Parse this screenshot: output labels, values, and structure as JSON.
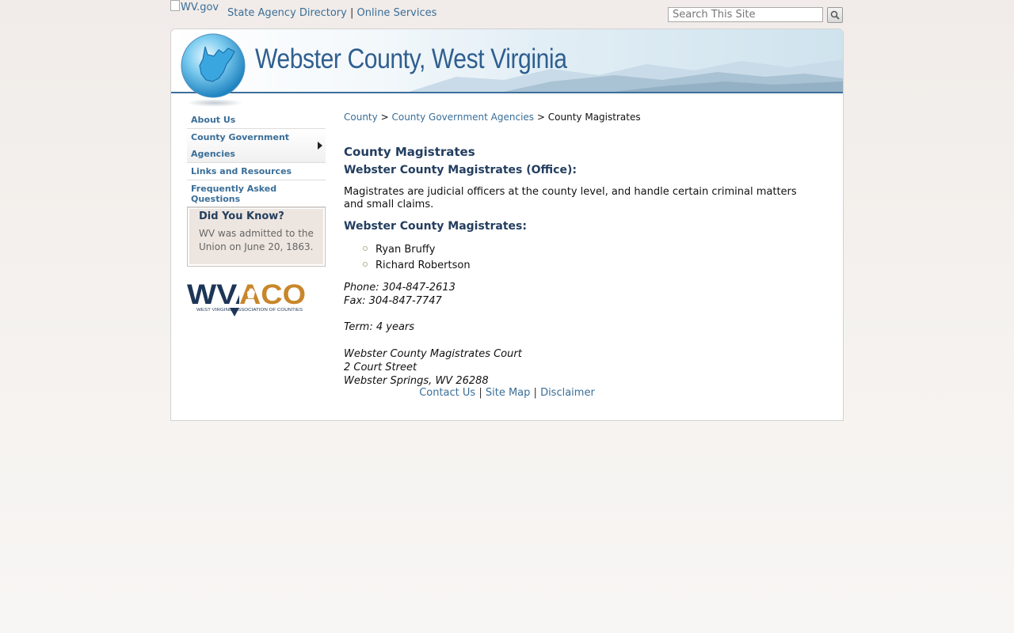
{
  "topbar": {
    "wvgov_alt": "WV.gov",
    "links": [
      {
        "label": "State Agency Directory"
      },
      {
        "label": "Online Services"
      }
    ],
    "separator": "|",
    "search_placeholder": "Search This Site"
  },
  "banner": {
    "title": "Webster County, West Virginia"
  },
  "sidebar": {
    "items": [
      {
        "label": "About Us"
      },
      {
        "label": "County Government Agencies"
      },
      {
        "label": "Links and Resources"
      },
      {
        "label": "Frequently Asked Questions"
      }
    ],
    "did_you_know": {
      "title": "Did You Know?",
      "text": "WV was admitted to the Union on June 20, 1863."
    },
    "partner_logo": {
      "wordmark": "WVACO",
      "tagline": "WEST VIRGINIA ASSOCIATION OF COUNTIES"
    }
  },
  "breadcrumb": {
    "items": [
      "County",
      "County Government Agencies"
    ],
    "sep": ">",
    "current": "County Magistrates"
  },
  "main": {
    "page_title": "County Magistrates",
    "office_heading": "Webster County Magistrates (Office):",
    "description": "Magistrates are judicial officers at the county level, and handle certain criminal matters and small claims.",
    "list_heading": "Webster County Magistrates:",
    "magistrates": [
      "Ryan Bruffy",
      "Richard Robertson"
    ],
    "phone": "Phone: 304-847-2613",
    "fax": "Fax: 304-847-7747",
    "term": "Term: 4 years",
    "address": [
      "Webster County Magistrates Court",
      "2 Court Street",
      "Webster Springs, WV 26288"
    ]
  },
  "footer": {
    "links": [
      {
        "label": "Contact Us"
      },
      {
        "label": "Site Map"
      },
      {
        "label": "Disclaimer"
      }
    ],
    "separator": "|"
  },
  "colors": {
    "link": "#3a6e98",
    "heading": "#233e5f",
    "banner_title": "#2f5f8f",
    "wvaco_navy": "#1d3557",
    "wvaco_gold": "#c8862b"
  }
}
